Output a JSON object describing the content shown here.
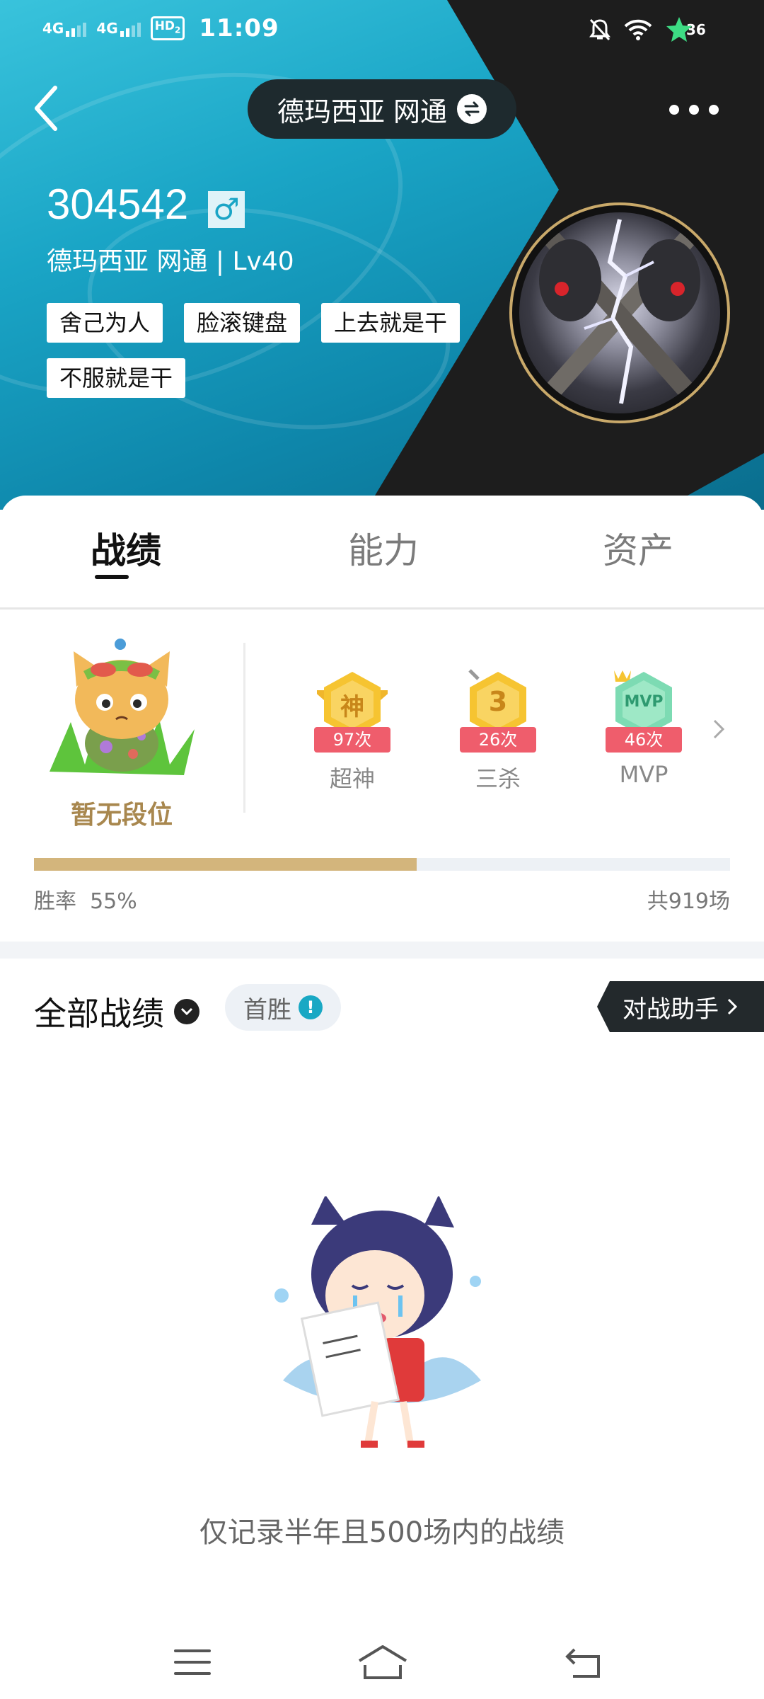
{
  "status_bar": {
    "network_1": "4G",
    "network_2": "4G",
    "hd": "HD",
    "hd_sub": "2",
    "time": "11:09",
    "battery": "36",
    "icons": [
      "mute-icon",
      "wifi-icon",
      "battery-leaf-icon"
    ]
  },
  "header": {
    "server": "德玛西亚 网通",
    "back_icon": "chevron-left-icon",
    "swap_icon": "swap-icon",
    "more_icon": "more-dots-icon"
  },
  "profile": {
    "player_id": "304542",
    "gender_symbol": "♂",
    "subtitle": "德玛西亚 网通 | Lv40",
    "tags": [
      "舍己为人",
      "脸滚键盘",
      "上去就是干",
      "不服就是干"
    ]
  },
  "tabs": [
    {
      "label": "战绩",
      "active": true
    },
    {
      "label": "能力",
      "active": false
    },
    {
      "label": "资产",
      "active": false
    }
  ],
  "rank": {
    "label": "暂无段位"
  },
  "badges": [
    {
      "glyph": "神",
      "count": "97次",
      "label": "超神",
      "color": "#f6c431"
    },
    {
      "glyph": "3",
      "count": "26次",
      "label": "三杀",
      "color": "#f6c431"
    },
    {
      "glyph": "MVP",
      "count": "46次",
      "label": "MVP",
      "color": "#7ddbb3"
    }
  ],
  "win_rate": {
    "label": "胜率",
    "value": "55%",
    "fraction": 0.55,
    "total": "共919场"
  },
  "records": {
    "filter_label": "全部战绩",
    "first_win_label": "首胜",
    "info_mark": "!",
    "assistant_label": "对战助手",
    "empty_text": "仅记录半年且500场内的战绩"
  },
  "nav": {
    "menu_icon": "menu-icon",
    "home_icon": "home-icon",
    "back_icon": "back-icon"
  },
  "colors": {
    "accent": "#19a8c4",
    "gold": "#d3b57c",
    "badge_ribbon": "#ef5d6c"
  }
}
